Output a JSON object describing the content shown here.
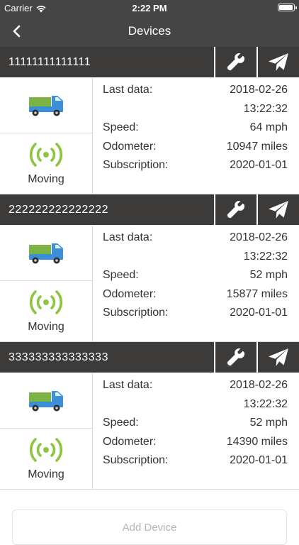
{
  "status": {
    "carrier": "Carrier",
    "time": "2:22 PM"
  },
  "nav": {
    "title": "Devices"
  },
  "labels": {
    "last_data": "Last data:",
    "speed": "Speed:",
    "odometer": "Odometer:",
    "subscription": "Subscription:"
  },
  "devices": [
    {
      "id": "11111111111111",
      "status": "Moving",
      "date": "2018-02-26",
      "time": "13:22:32",
      "speed": "64 mph",
      "odometer": "10947 miles",
      "subscription": "2020-01-01"
    },
    {
      "id": "222222222222222",
      "status": "Moving",
      "date": "2018-02-26",
      "time": "13:22:32",
      "speed": "52 mph",
      "odometer": "15877 miles",
      "subscription": "2020-01-01"
    },
    {
      "id": "333333333333333",
      "status": "Moving",
      "date": "2018-02-26",
      "time": "13:22:32",
      "speed": "52 mph",
      "odometer": "14390 miles",
      "subscription": "2020-01-01"
    }
  ],
  "add_button": "Add Device",
  "icons": {
    "back": "chevron-left-icon",
    "settings": "wrench-icon",
    "send": "paper-plane-icon",
    "truck": "truck-icon",
    "signal": "signal-broadcast-icon",
    "wifi": "wifi-icon",
    "battery": "battery-icon"
  },
  "colors": {
    "header_bg": "#454545",
    "device_header_bg": "#3d3a3a",
    "signal_green": "#8cc63f",
    "truck_blue": "#3a8fd6",
    "truck_green": "#7cb342"
  }
}
